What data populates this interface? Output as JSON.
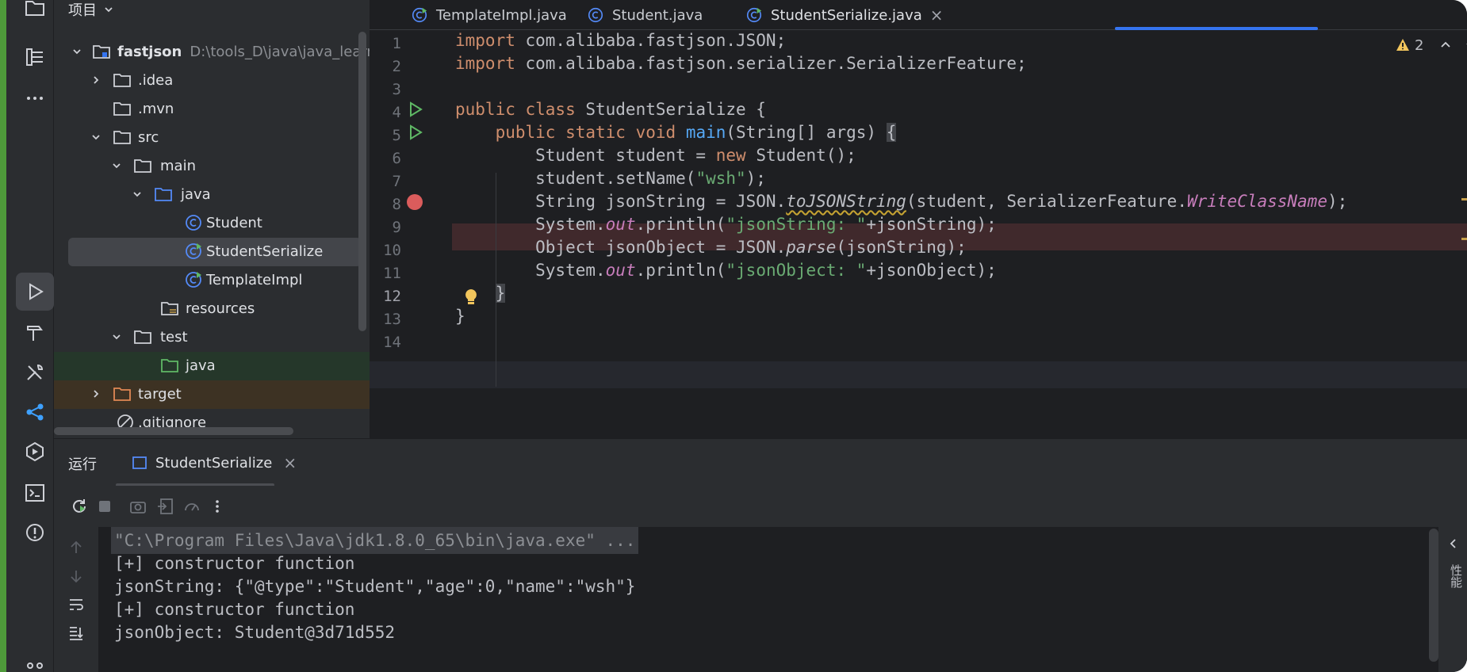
{
  "project": {
    "title": "项目",
    "root_name": "fastjson",
    "root_path": "D:\\tools_D\\java\\java_learn\\fa",
    "items": [
      {
        "label": ".idea"
      },
      {
        "label": ".mvn"
      },
      {
        "label": "src"
      },
      {
        "label": "main"
      },
      {
        "label": "java"
      },
      {
        "label": "Student"
      },
      {
        "label": "StudentSerialize"
      },
      {
        "label": "TemplateImpl"
      },
      {
        "label": "resources"
      },
      {
        "label": "test"
      },
      {
        "label": "java"
      },
      {
        "label": "target"
      },
      {
        "label": ".gitignore"
      }
    ]
  },
  "tabs": [
    {
      "label": "TemplateImpl.java"
    },
    {
      "label": "Student.java"
    },
    {
      "label": "StudentSerialize.java",
      "close": "×"
    }
  ],
  "editor": {
    "warning_count": "2",
    "line_numbers": [
      "1",
      "2",
      "3",
      "4",
      "5",
      "6",
      "7",
      "8",
      "9",
      "10",
      "11",
      "12",
      "13",
      "14"
    ]
  },
  "run": {
    "title": "运行",
    "tab_label": "StudentSerialize",
    "tab_close": "×",
    "output": [
      "\"C:\\Program Files\\Java\\jdk1.8.0_65\\bin\\java.exe\" ...",
      "[+] constructor function",
      "jsonString: {\"@type\":\"Student\",\"age\":0,\"name\":\"wsh\"}",
      "[+] constructor function",
      "jsonObject: Student@3d71d552"
    ]
  },
  "side_label": "性能",
  "colors": {
    "accent": "#3574f0",
    "breakpoint": "#db5c5c",
    "run_green": "#5fb865"
  }
}
